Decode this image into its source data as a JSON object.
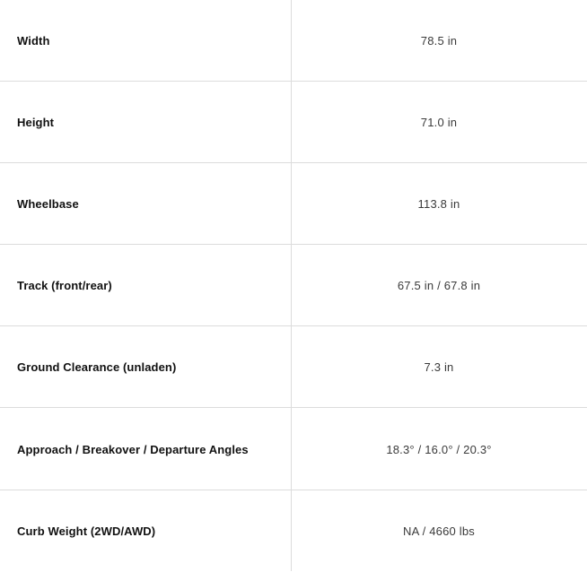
{
  "specs": [
    {
      "label": "Width",
      "value": "78.5 in"
    },
    {
      "label": "Height",
      "value": "71.0 in"
    },
    {
      "label": "Wheelbase",
      "value": "113.8 in"
    },
    {
      "label": "Track (front/rear)",
      "value": "67.5 in / 67.8 in"
    },
    {
      "label": "Ground Clearance (unladen)",
      "value": "7.3 in"
    },
    {
      "label": "Approach / Breakover / Departure Angles",
      "value": "18.3° / 16.0° / 20.3°"
    },
    {
      "label": "Curb Weight (2WD/AWD)",
      "value": "NA / 4660 lbs"
    }
  ]
}
